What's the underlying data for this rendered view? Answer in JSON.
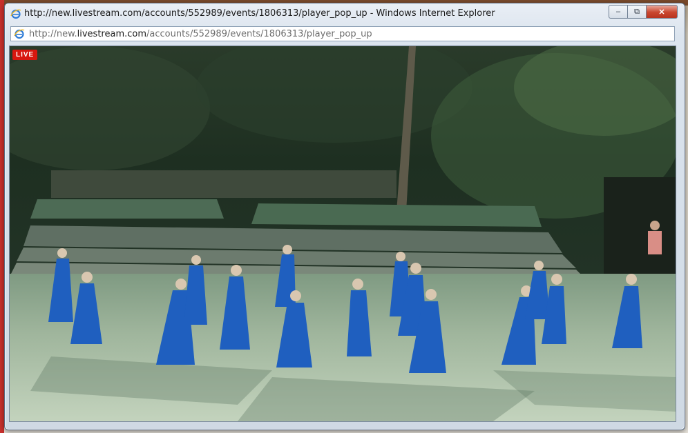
{
  "window": {
    "title": "http://new.livestream.com/accounts/552989/events/1806313/player_pop_up - Windows Internet Explorer",
    "minimize_icon": "minimize-icon",
    "restore_icon": "restore-icon",
    "close_icon": "close-icon"
  },
  "address": {
    "prefix": "http://new.",
    "host": "livestream.com",
    "path": "/accounts/552989/events/1806313/player_pop_up"
  },
  "player": {
    "badge": "LIVE",
    "scene": "hula-performance-video"
  },
  "colors": {
    "live_badge": "#d8170f",
    "dress_blue": "#1f5fbf",
    "stage_floor": "#a9bfa4"
  }
}
